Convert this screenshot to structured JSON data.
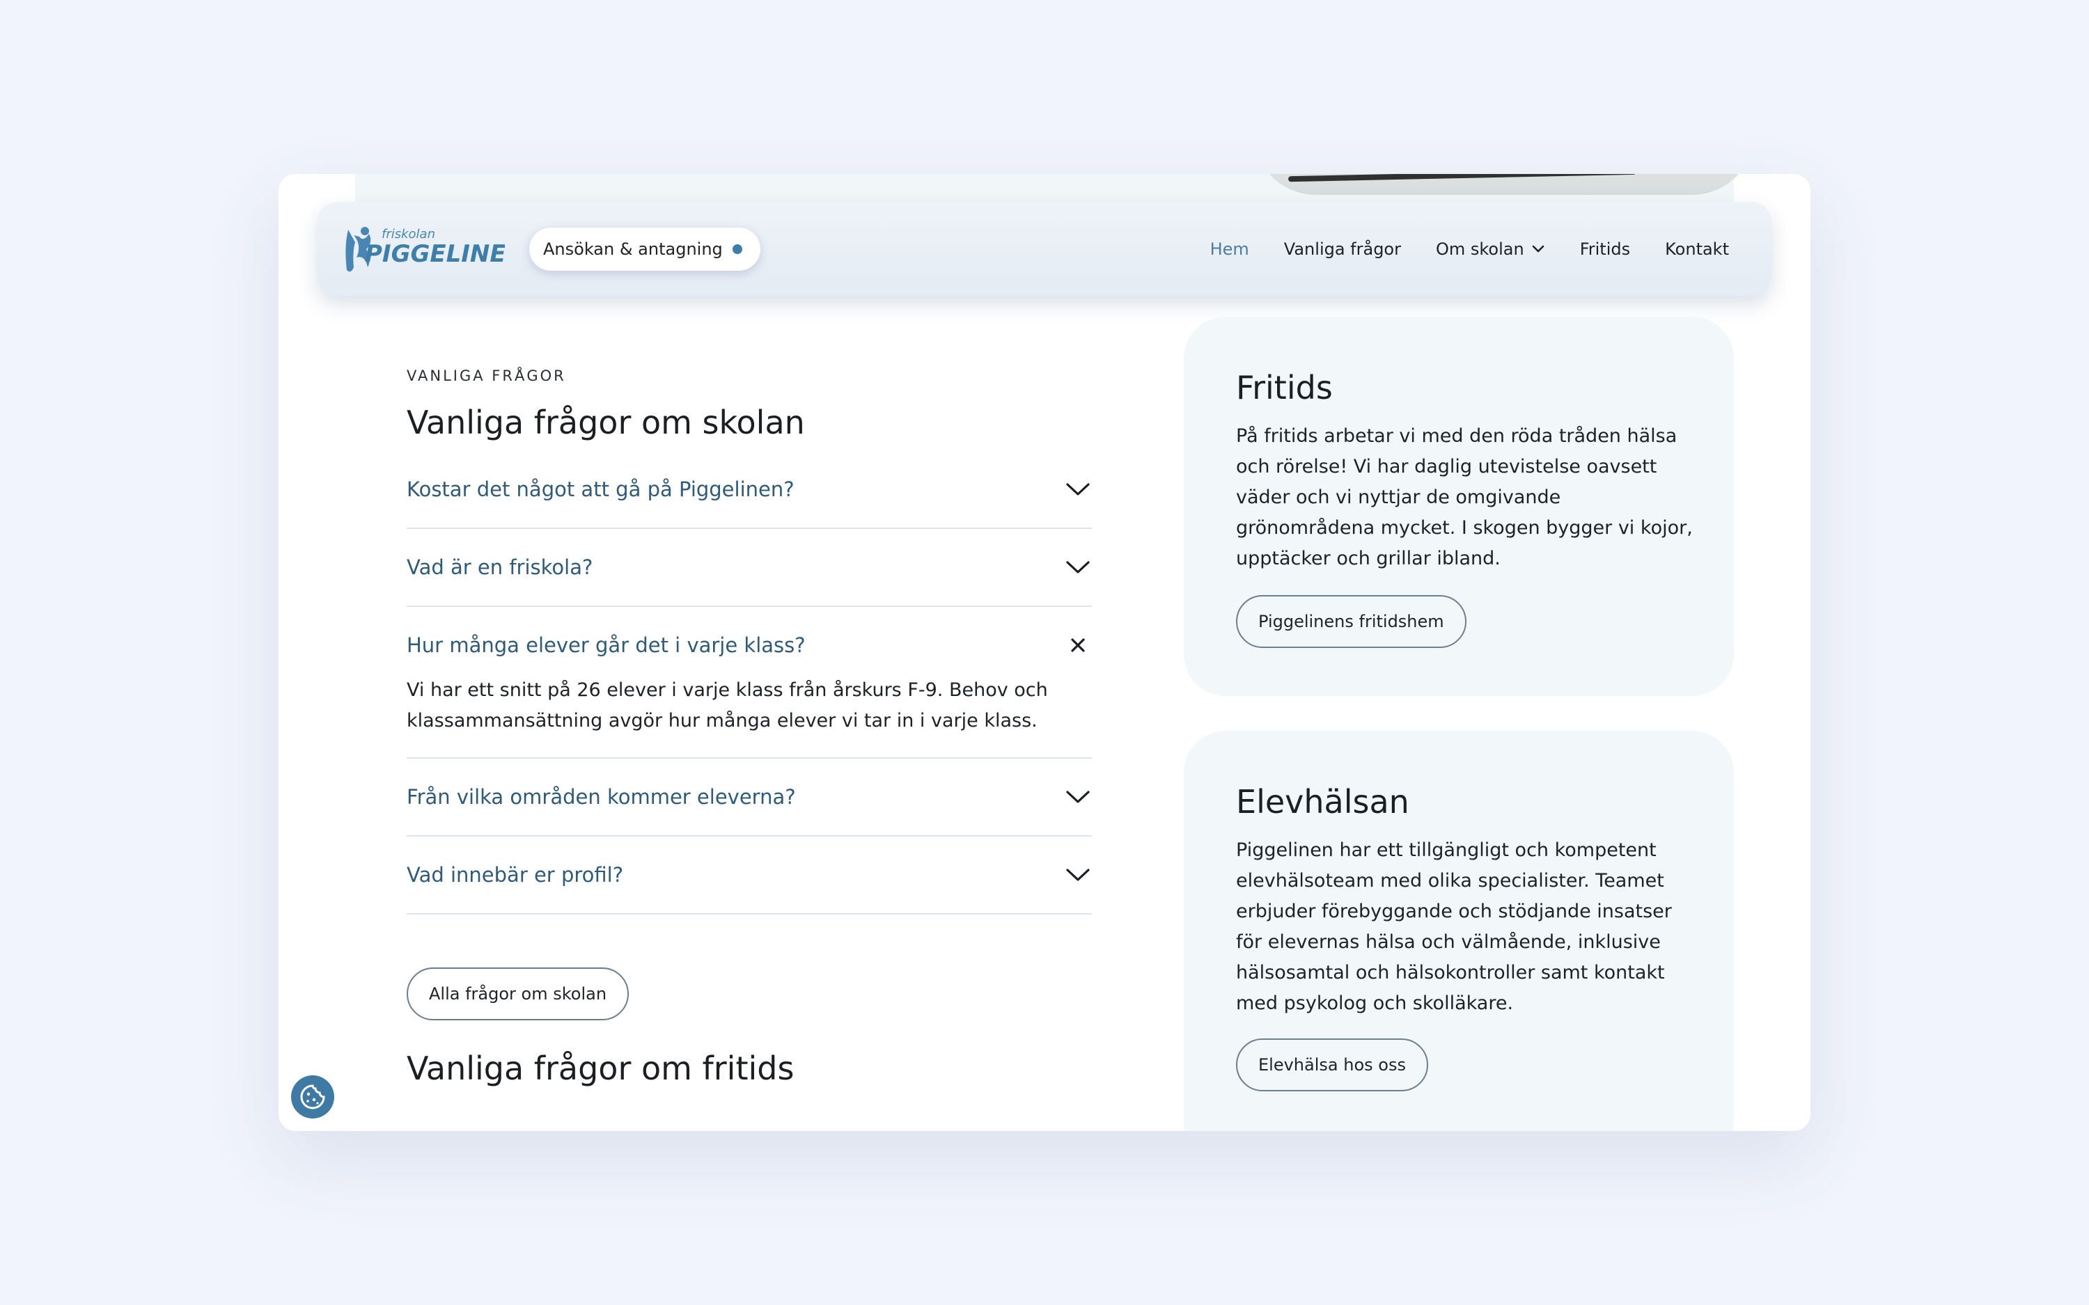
{
  "nav": {
    "logo_alt": "Friskolan Piggelinen",
    "logo_small": "friskolan",
    "logo_big": "PIGGELINEN",
    "admission_pill": "Ansökan & antagning",
    "links": [
      "Hem",
      "Vanliga frågor",
      "Om skolan",
      "Fritids",
      "Kontakt"
    ],
    "active_link": "Hem"
  },
  "faq_section": {
    "eyebrow": "VANLIGA FRÅGOR",
    "heading": "Vanliga frågor om skolan",
    "items": [
      {
        "question": "Kostar det något att gå på Piggelinen?",
        "expanded": false
      },
      {
        "question": "Vad är en friskola?",
        "expanded": false
      },
      {
        "question": "Hur många elever går det i varje klass?",
        "expanded": true,
        "answer": "Vi har ett snitt på 26 elever i varje klass från årskurs F-9. Behov och klassammansättning avgör hur många elever vi tar in i varje klass."
      },
      {
        "question": "Från vilka områden kommer eleverna?",
        "expanded": false
      },
      {
        "question": "Vad innebär er profil?",
        "expanded": false
      }
    ],
    "all_button": "Alla frågor om skolan",
    "next_heading": "Vanliga frågor om fritids"
  },
  "cards": [
    {
      "title": "Fritids",
      "text": "På fritids arbetar vi med den röda tråden hälsa och rörelse! Vi har daglig utevistelse oavsett väder och vi nyttjar de omgivande grönområdena mycket. I skogen bygger vi kojor, upptäcker och grillar ibland.",
      "button": "Piggelinens fritidshem"
    },
    {
      "title": "Elevhälsan",
      "text": "Piggelinen har ett tillgängligt och kompetent elevhälsoteam med olika specialister. Teamet erbjuder förebyggande och stödjande insatser för elevernas hälsa och välmående, inklusive hälsosamtal och hälsokontroller samt kontakt med psykolog och skolläkare.",
      "button": "Elevhälsa hos oss"
    }
  ],
  "colors": {
    "page_bg": "#f1f4fc",
    "accent": "#3f7ea8",
    "question_text": "#2f5a78",
    "card_bg": "#f2f7fa"
  },
  "icons": {
    "faq_collapsed": "chevron-down-icon",
    "faq_expanded": "close-icon",
    "cookie": "cookie-icon"
  }
}
